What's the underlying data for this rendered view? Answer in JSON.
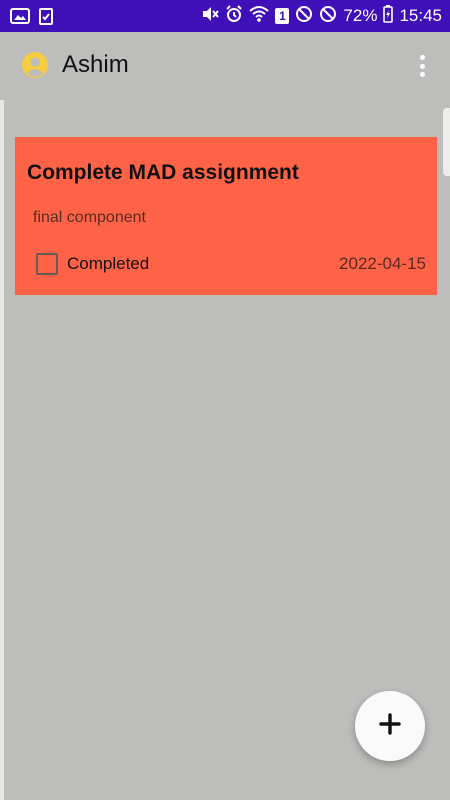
{
  "colors": {
    "status_bar": "#3f0fb8",
    "background": "#bdbdbb",
    "card": "#ff6347",
    "avatar": "#f5cd3f",
    "fab": "#fafafa"
  },
  "status_bar": {
    "left_icons": [
      "image-icon",
      "clipboard-check-icon"
    ],
    "right_icons": [
      "mute-icon",
      "alarm-icon",
      "wifi-icon",
      "sim-badge-icon",
      "dnd-icon",
      "blocked-icon",
      "battery-charging-icon"
    ],
    "sim_slot": "1",
    "battery": "72%",
    "time": "15:45"
  },
  "app_bar": {
    "title": "Ashim",
    "avatar_icon": "account-circle-icon",
    "menu_icon": "more-vert-icon"
  },
  "tasks": [
    {
      "title": "Complete MAD assignment",
      "description": "final component",
      "checkbox_label": "Completed",
      "checked": false,
      "date": "2022-04-15"
    }
  ],
  "fab": {
    "icon": "plus-icon"
  }
}
